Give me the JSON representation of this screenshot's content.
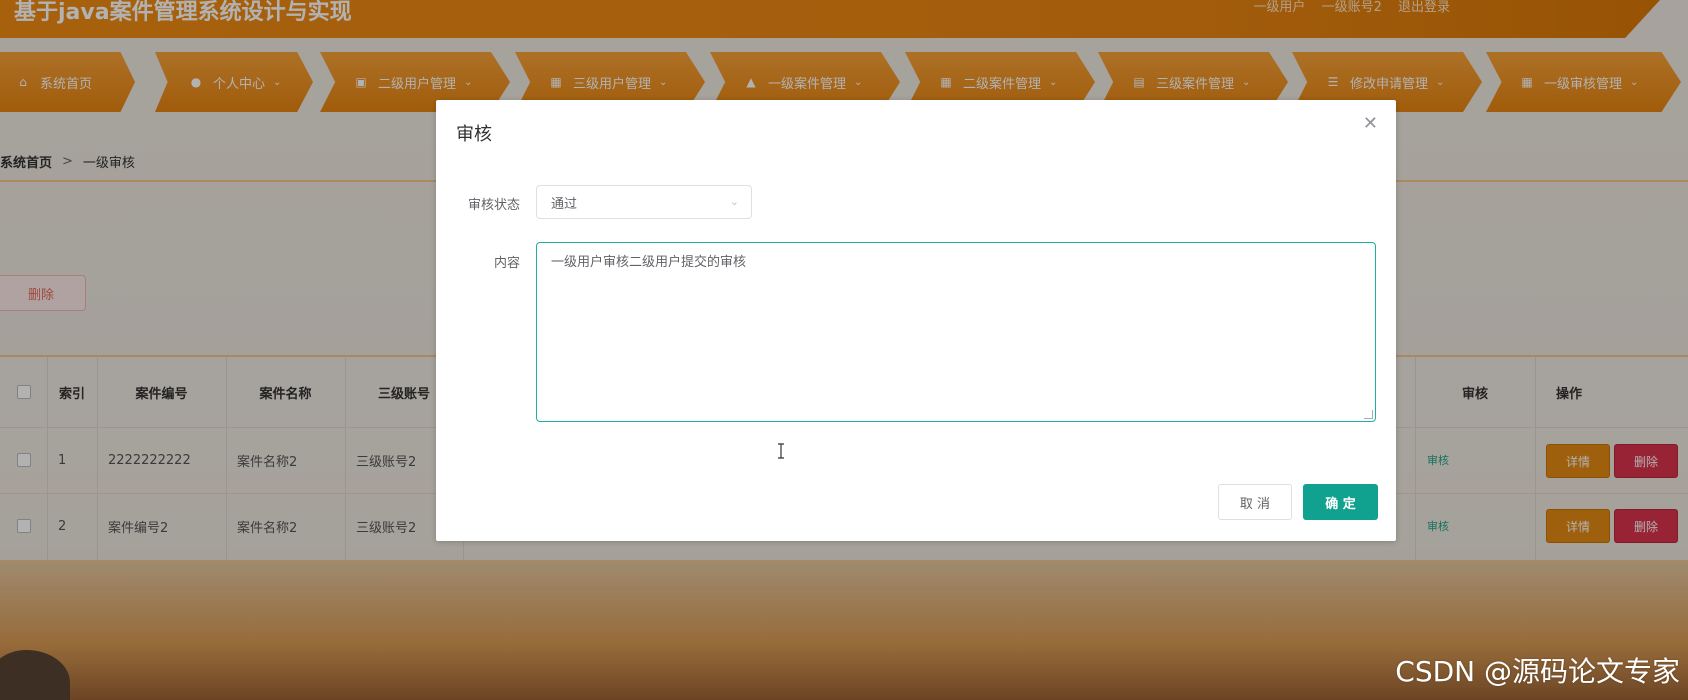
{
  "app": {
    "title": "基于java案件管理系统设计与实现",
    "user_role": "一级用户",
    "user_account": "一级账号2",
    "logout": "退出登录"
  },
  "nav": {
    "items": [
      {
        "label": "系统首页",
        "icon": "home-icon",
        "glyph": "⌂",
        "chevron": false
      },
      {
        "label": "个人中心",
        "icon": "person-icon",
        "glyph": "●",
        "chevron": true
      },
      {
        "label": "二级用户管理",
        "icon": "clipboard-icon",
        "glyph": "▣",
        "chevron": true
      },
      {
        "label": "三级用户管理",
        "icon": "grid-icon",
        "glyph": "▦",
        "chevron": true
      },
      {
        "label": "一级案件管理",
        "icon": "thumbs-up-icon",
        "glyph": "▲",
        "chevron": true
      },
      {
        "label": "二级案件管理",
        "icon": "grid-icon",
        "glyph": "▦",
        "chevron": true
      },
      {
        "label": "三级案件管理",
        "icon": "printer-icon",
        "glyph": "▤",
        "chevron": true
      },
      {
        "label": "修改申请管理",
        "icon": "list-icon",
        "glyph": "☰",
        "chevron": true
      },
      {
        "label": "一级审核管理",
        "icon": "grid-icon",
        "glyph": "▦",
        "chevron": true
      }
    ]
  },
  "breadcrumb": {
    "home": "系统首页",
    "separator": ">",
    "current": "一级审核"
  },
  "toolbar": {
    "delete_label": "删除"
  },
  "table": {
    "columns": [
      "",
      "索引",
      "案件编号",
      "案件名称",
      "三级账号",
      "审核",
      "操作"
    ],
    "rows": [
      {
        "index": "1",
        "case_no": "2222222222",
        "case_name": "案件名称2",
        "account": "三级账号2",
        "review": "审核",
        "detail": "详情",
        "delete": "删除"
      },
      {
        "index": "2",
        "case_no": "案件编号2",
        "case_name": "案件名称2",
        "account": "三级账号2",
        "review": "审核",
        "detail": "详情",
        "delete": "删除"
      }
    ]
  },
  "dialog": {
    "title": "审核",
    "status_label": "审核状态",
    "status_value": "通过",
    "content_label": "内容",
    "content_value": "一级用户审核二级用户提交的审核",
    "cancel_label": "取 消",
    "confirm_label": "确 定"
  },
  "watermark": "CSDN @源码论文专家",
  "colors": {
    "accent": "#e98512",
    "confirm": "#10a28f",
    "danger": "#d9334c"
  }
}
